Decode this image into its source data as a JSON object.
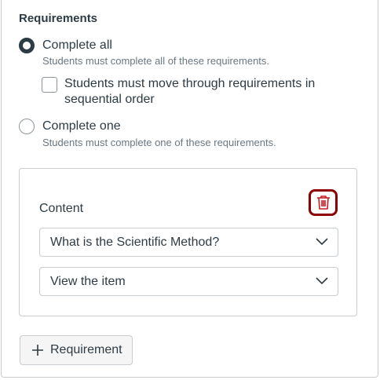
{
  "requirements": {
    "title": "Requirements",
    "options": [
      {
        "label": "Complete all",
        "helper": "Students must complete all of these requirements.",
        "selected": true
      },
      {
        "label": "Complete one",
        "helper": "Students must complete one of these requirements.",
        "selected": false
      }
    ],
    "sequential_checkbox": {
      "label": "Students must move through requirements in sequential order",
      "checked": false
    }
  },
  "content_card": {
    "label": "Content",
    "delete_icon": "trash-icon",
    "item_select": {
      "value": "What is the Scientific Method?"
    },
    "action_select": {
      "value": "View the item"
    }
  },
  "add_requirement": {
    "icon": "plus-icon",
    "label": "Requirement"
  },
  "colors": {
    "delete_border": "#8B0000",
    "delete_icon": "#C91E25",
    "text": "#2D3B45",
    "helper": "#6B7780"
  }
}
